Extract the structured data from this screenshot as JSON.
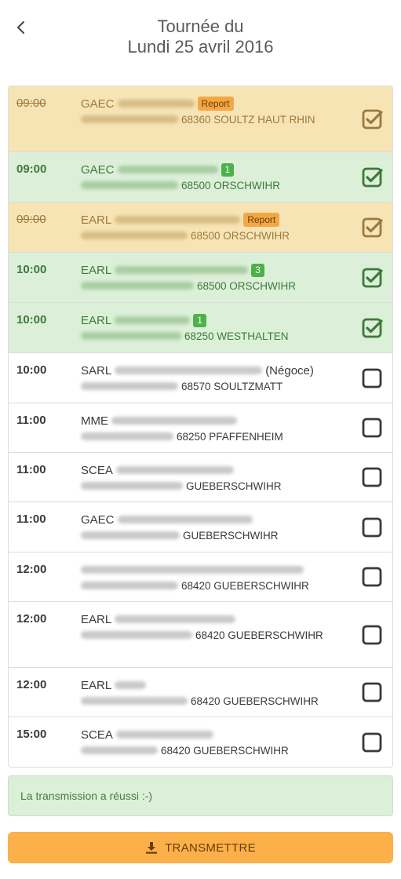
{
  "header": {
    "title_line1": "Tournée du",
    "title_line2": "Lundi 25 avril 2016"
  },
  "icons": {
    "back": "chevron-left-icon",
    "checked": "check-square-icon",
    "unchecked": "square-icon",
    "download": "download-icon"
  },
  "colors": {
    "report_bg": "#f7e4b5",
    "done_bg": "#dcefd8",
    "report_text": "#9a7a3e",
    "done_text": "#3d7a3a",
    "report_badge": "#f3a845",
    "count_badge": "#4db04a",
    "button": "#fbb04a"
  },
  "visits": [
    {
      "time": "09:00",
      "type": "GAEC",
      "badge": "Report",
      "address_tail": "68360 SOULTZ HAUT RHIN",
      "status": "report",
      "checked": true
    },
    {
      "time": "09:00",
      "type": "GAEC",
      "badge": "1",
      "address_tail": "68500 ORSCHWIHR",
      "status": "done",
      "checked": true
    },
    {
      "time": "09:00",
      "type": "EARL",
      "badge": "Report",
      "address_tail": "68500 ORSCHWIHR",
      "status": "report",
      "checked": true
    },
    {
      "time": "10:00",
      "type": "EARL",
      "badge": "3",
      "address_tail": "68500 ORSCHWIHR",
      "status": "done",
      "checked": true
    },
    {
      "time": "10:00",
      "type": "EARL",
      "badge": "1",
      "address_tail": "68250 WESTHALTEN",
      "status": "done",
      "checked": true
    },
    {
      "time": "10:00",
      "type": "SARL",
      "suffix": "(Négoce)",
      "address_tail": "68570 SOULTZMATT",
      "status": "todo",
      "checked": false
    },
    {
      "time": "11:00",
      "type": "MME",
      "address_tail": "68250 PFAFFENHEIM",
      "status": "todo",
      "checked": false
    },
    {
      "time": "11:00",
      "type": "SCEA",
      "address_tail": "GUEBERSCHWIHR",
      "status": "todo",
      "checked": false
    },
    {
      "time": "11:00",
      "type": "GAEC",
      "address_tail": "GUEBERSCHWIHR",
      "status": "todo",
      "checked": false
    },
    {
      "time": "12:00",
      "type": "",
      "address_tail": "68420 GUEBERSCHWIHR",
      "status": "todo",
      "checked": false
    },
    {
      "time": "12:00",
      "type": "EARL",
      "address_tail": "68420 GUEBERSCHWIHR",
      "status": "todo",
      "checked": false
    },
    {
      "time": "12:00",
      "type": "EARL",
      "address_tail": "68420 GUEBERSCHWIHR",
      "status": "todo",
      "checked": false
    },
    {
      "time": "15:00",
      "type": "SCEA",
      "address_tail": "68420 GUEBERSCHWIHR",
      "status": "todo",
      "checked": false
    }
  ],
  "message": "La transmission a réussi :-)",
  "transmit_label": "TRANSMETTRE"
}
